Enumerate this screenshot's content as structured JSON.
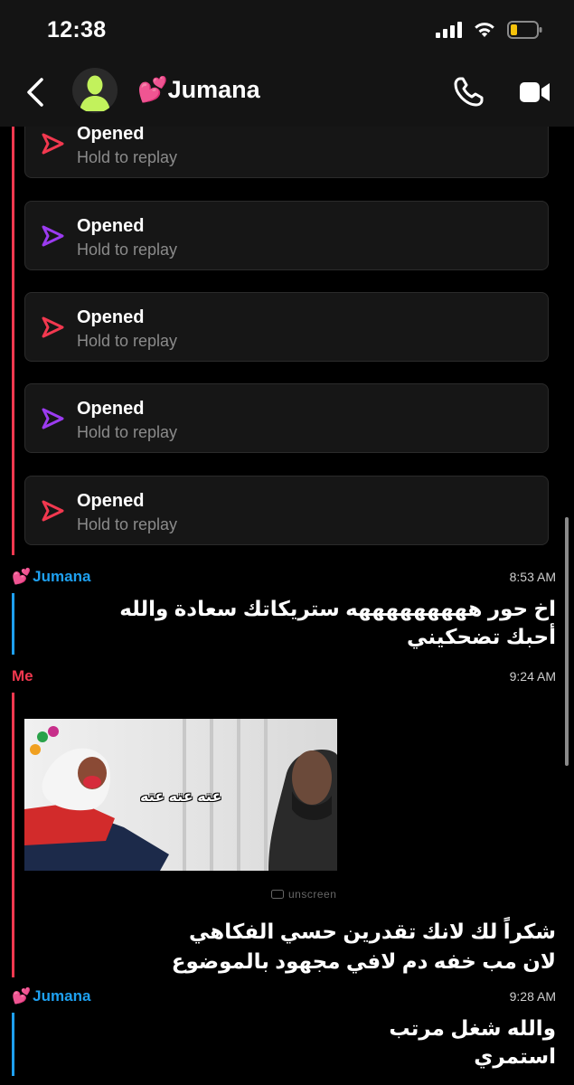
{
  "status_bar": {
    "time": "12:38"
  },
  "header": {
    "emoji": "💕",
    "name": "Jumana",
    "title_emoji_name": "💕Jumana"
  },
  "snaps": [
    {
      "status": "Opened",
      "sub": "Hold to replay",
      "color": "#f2384f"
    },
    {
      "status": "Opened",
      "sub": "Hold to replay",
      "color": "#9b3bf0"
    },
    {
      "status": "Opened",
      "sub": "Hold to replay",
      "color": "#f2384f"
    },
    {
      "status": "Opened",
      "sub": "Hold to replay",
      "color": "#9b3bf0"
    },
    {
      "status": "Opened",
      "sub": "Hold to replay",
      "color": "#f2384f"
    }
  ],
  "messages": [
    {
      "sender_emoji": "💕",
      "sender": "Jumana",
      "time": "8:53 AM",
      "line1": "اخ حور هههههههههه ستريكاتك سعادة والله",
      "line2": "أحبك تضحكيني"
    },
    {
      "sender": "Me",
      "time": "9:24 AM",
      "gif_caption": "عته عته عته",
      "watermark": "unscreen",
      "line1": "شكراً لك لانك تقدرين حسي الفكاهي",
      "line2": "لان مب خفه دم لافي مجهود بالموضوع"
    },
    {
      "sender_emoji": "💕",
      "sender": "Jumana",
      "time": "9:28 AM",
      "line1": "والله شغل مرتب",
      "line2": "استمري"
    }
  ],
  "colors": {
    "me_red": "#f2384f",
    "friend_blue": "#1ea0f0",
    "snap_purple": "#9b3bf0"
  }
}
